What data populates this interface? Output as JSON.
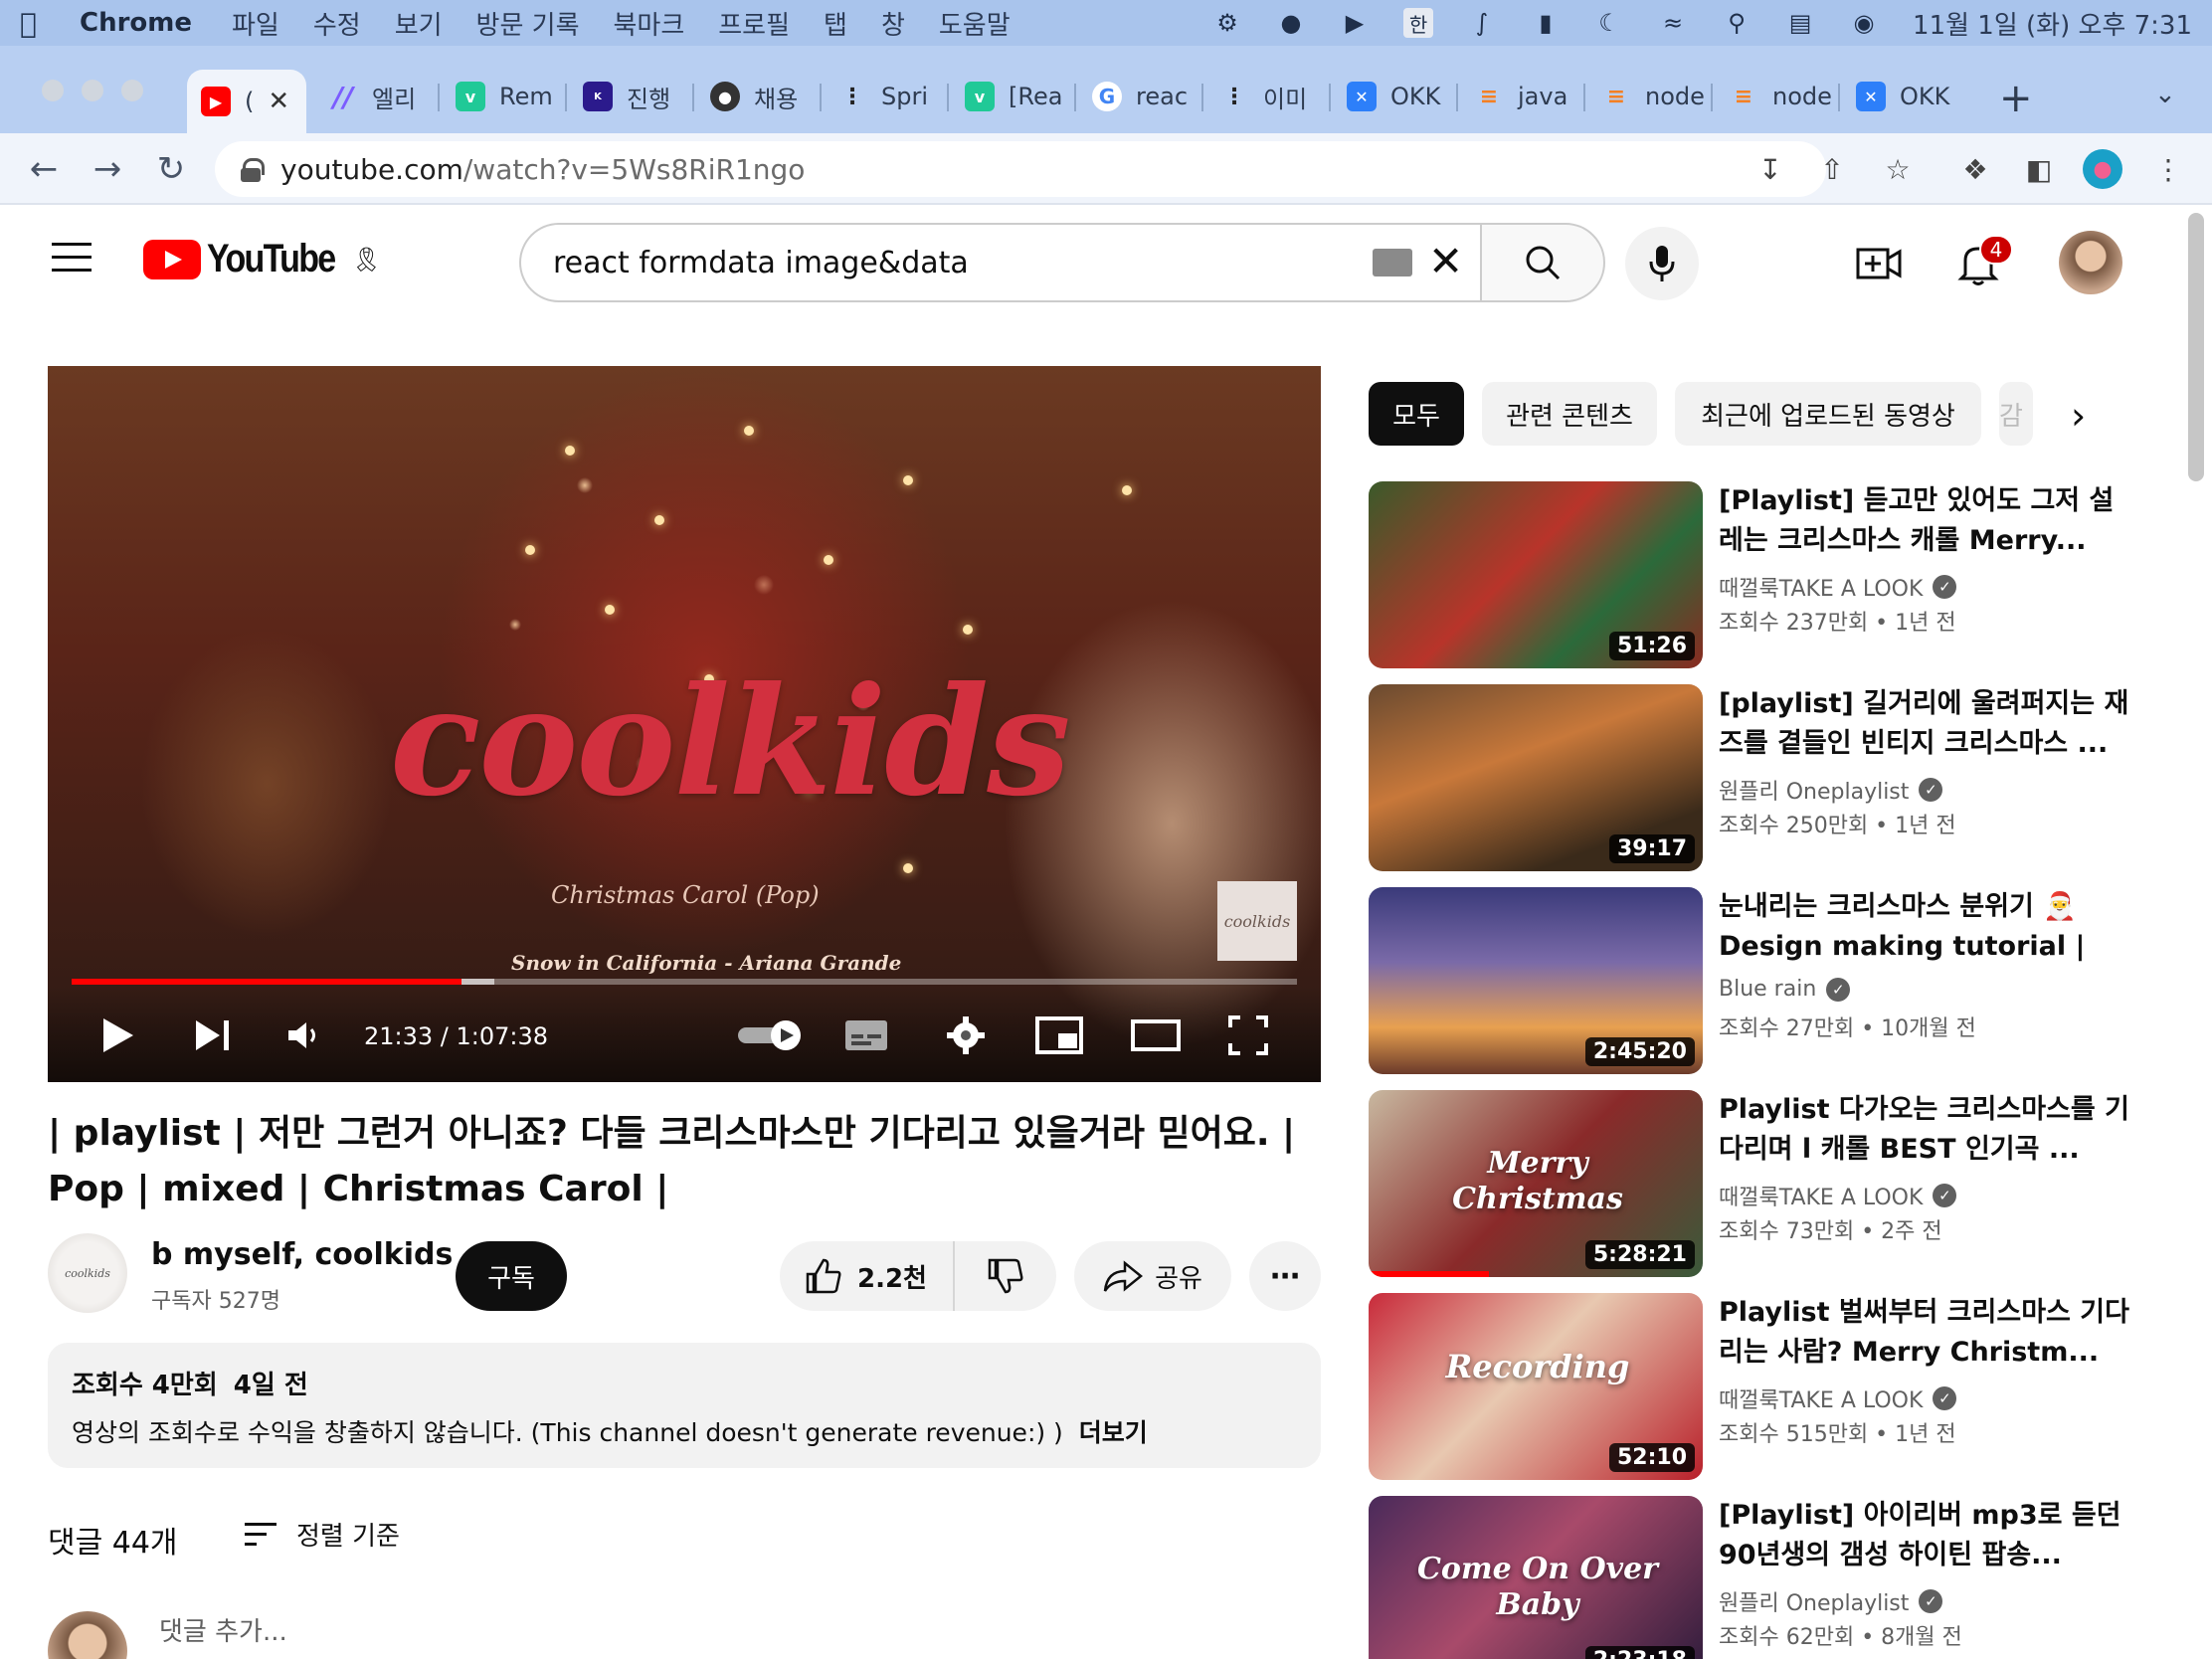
{
  "menubar": {
    "app": "Chrome",
    "items": [
      "파일",
      "수정",
      "보기",
      "방문 기록",
      "북마크",
      "프로필",
      "탭",
      "창",
      "도움말"
    ],
    "input_method": "한",
    "clock": "11월 1일 (화) 오후 7:31"
  },
  "tabs": [
    {
      "label": "(",
      "favicon": "youtube-icon",
      "color": "#ff0000",
      "active": true
    },
    {
      "label": "엘리",
      "favicon": "slash-icon",
      "color": "#7b5cff"
    },
    {
      "label": "Rem",
      "favicon": "v-icon",
      "color": "#20c997"
    },
    {
      "label": "진행",
      "favicon": "kbank-icon",
      "color": "#2b1a8c"
    },
    {
      "label": "채용",
      "favicon": "globe-icon",
      "color": "#333333"
    },
    {
      "label": "Spri",
      "favicon": "dots-icon",
      "color": "#222222"
    },
    {
      "label": "[Rea",
      "favicon": "v-icon",
      "color": "#20c997"
    },
    {
      "label": "reac",
      "favicon": "google-icon",
      "color": "#4285f4"
    },
    {
      "label": "이미",
      "favicon": "dots-icon",
      "color": "#222222"
    },
    {
      "label": "OKK",
      "favicon": "okky-icon",
      "color": "#2d7ff9"
    },
    {
      "label": "java",
      "favicon": "stack-icon",
      "color": "#f48024"
    },
    {
      "label": "node",
      "favicon": "stack-icon",
      "color": "#f48024"
    },
    {
      "label": "node",
      "favicon": "stack-icon",
      "color": "#f48024"
    },
    {
      "label": "OKK",
      "favicon": "okky-icon",
      "color": "#2d7ff9"
    }
  ],
  "address": {
    "host": "youtube.com",
    "path": "/watch?v=5Ws8RiR1ngo"
  },
  "youtube": {
    "logo": "YouTube",
    "search_query": "react formdata image&data",
    "notification_count": "4"
  },
  "player": {
    "overlay_title": "coolkids",
    "overlay_sub1": "Christmas Carol (Pop)",
    "overlay_sub2": "Snow in California - Ariana Grande",
    "watermark": "coolkids",
    "current_time": "21:33",
    "duration": "1:07:38",
    "timecode": "21:33 / 1:07:38",
    "progress_fraction": 0.318,
    "buffered_fraction": 0.345
  },
  "video": {
    "title": "| playlist | 저만 그런거 아니죠? 다들 크리스마스만 기다리고 있을거라 믿어요. | Pop | mixed | Christmas Carol |",
    "channel_name": "b myself, coolkids",
    "channel_avatar_text": "coolkids",
    "subscribers": "구독자 527명",
    "subscribe_label": "구독",
    "likes": "2.2천",
    "share_label": "공유",
    "views": "조회수 4만회",
    "date": "4일 전",
    "description": "영상의 조회수로 수익을 창출하지 않습니다. (This channel doesn't generate revenue:) )",
    "more_label": "더보기"
  },
  "comments": {
    "count": "댓글 44개",
    "sort_label": "정렬 기준",
    "add_placeholder": "댓글 추가..."
  },
  "chips": [
    "모두",
    "관련 콘텐츠",
    "최근에 업로드된 동영상",
    "감"
  ],
  "recommendations": [
    {
      "title": "[Playlist] 듣고만 있어도 그저 설레는 크리스마스 캐롤 Merry...",
      "channel": "때껄룩TAKE A LOOK",
      "views": "조회수 237만회",
      "age": "1년 전",
      "duration": "51:26",
      "thumb_text": "",
      "bg": "linear-gradient(135deg,#3a5a2a,#b8342a 45%,#2b6a3a 70%,#8a2a20)"
    },
    {
      "title": "[playlist] 길거리에 울려퍼지는 재즈를 곁들인 빈티지 크리스마스 ...",
      "channel": "원플리 Oneplaylist",
      "views": "조회수 250만회",
      "age": "1년 전",
      "duration": "39:17",
      "thumb_text": "",
      "bg": "linear-gradient(160deg,#6a4a30,#c8783a 40%,#3a2a1a 80%)"
    },
    {
      "title": "눈내리는 크리스마스 분위기 🎅 Design making tutorial | 크...",
      "channel": "Blue rain",
      "views": "조회수 27만회",
      "age": "10개월 전",
      "duration": "2:45:20",
      "thumb_text": "",
      "bg": "linear-gradient(180deg,#3a3a7a,#7a6aa8 40%,#e8a050 75%,#6a3a2a)"
    },
    {
      "title": "Playlist 다가오는 크리스마스를 기다리며 l 캐롤 BEST 인기곡 ...",
      "channel": "때껄룩TAKE A LOOK",
      "views": "조회수 73만회",
      "age": "2주 전",
      "duration": "5:28:21",
      "thumb_text": "Merry Christmas",
      "bg": "linear-gradient(135deg,#c8b8a0,#8a2a2a 50%,#3a5a3a)",
      "watched_fraction": 0.36
    },
    {
      "title": "Playlist 벌써부터 크리스마스 기다리는 사람? Merry Christm...",
      "channel": "때껄룩TAKE A LOOK",
      "views": "조회수 515만회",
      "age": "1년 전",
      "duration": "52:10",
      "thumb_text": "Recording",
      "bg": "linear-gradient(135deg,#c82a3a,#e8c8b0 45%,#b8202a)"
    },
    {
      "title": "[Playlist] 아이리버 mp3로 듣던 90년생의 갬성 하이틴 팝송...",
      "channel": "원플리 Oneplaylist",
      "views": "조회수 62만회",
      "age": "8개월 전",
      "duration": "2:23:18",
      "thumb_text": "Come On Over Baby",
      "bg": "linear-gradient(135deg,#4a2a5a,#a84a6a 45%,#2a1a3a)"
    }
  ]
}
